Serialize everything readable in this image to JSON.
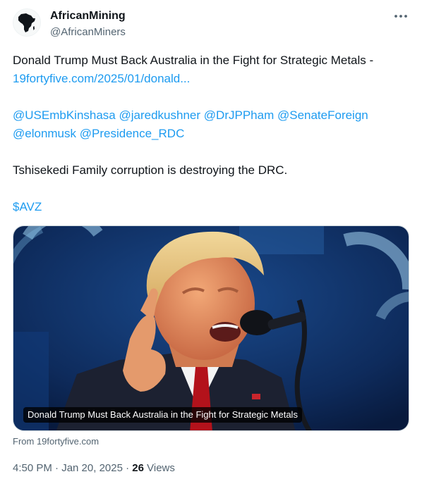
{
  "author": {
    "name": "AfricanMining",
    "handle": "@AfricanMiners"
  },
  "tweet": {
    "line1": "Donald Trump Must Back Australia in the Fight for Strategic Metals - ",
    "link": "19fortyfive.com/2025/01/donald...",
    "mentions": [
      "@USEmbKinshasa",
      "@jaredkushner",
      "@DrJPPham",
      "@SenateForeign",
      "@elonmusk",
      "@Presidence_RDC"
    ],
    "line2": "Tshisekedi Family corruption is destroying the DRC.",
    "cashtag": "$AVZ"
  },
  "card": {
    "caption": "Donald Trump Must Back Australia in the Fight for Strategic Metals",
    "source": "From 19fortyfive.com"
  },
  "meta": {
    "time": "4:50 PM · Jan 20, 2025",
    "separator": " · ",
    "views_count": "26",
    "views_label": " Views"
  },
  "icons": {
    "avatar": "africa-map-icon",
    "more": "more-horizontal-icon"
  },
  "colors": {
    "link": "#1d9bf0",
    "text": "#0f1419",
    "secondary": "#536471"
  }
}
